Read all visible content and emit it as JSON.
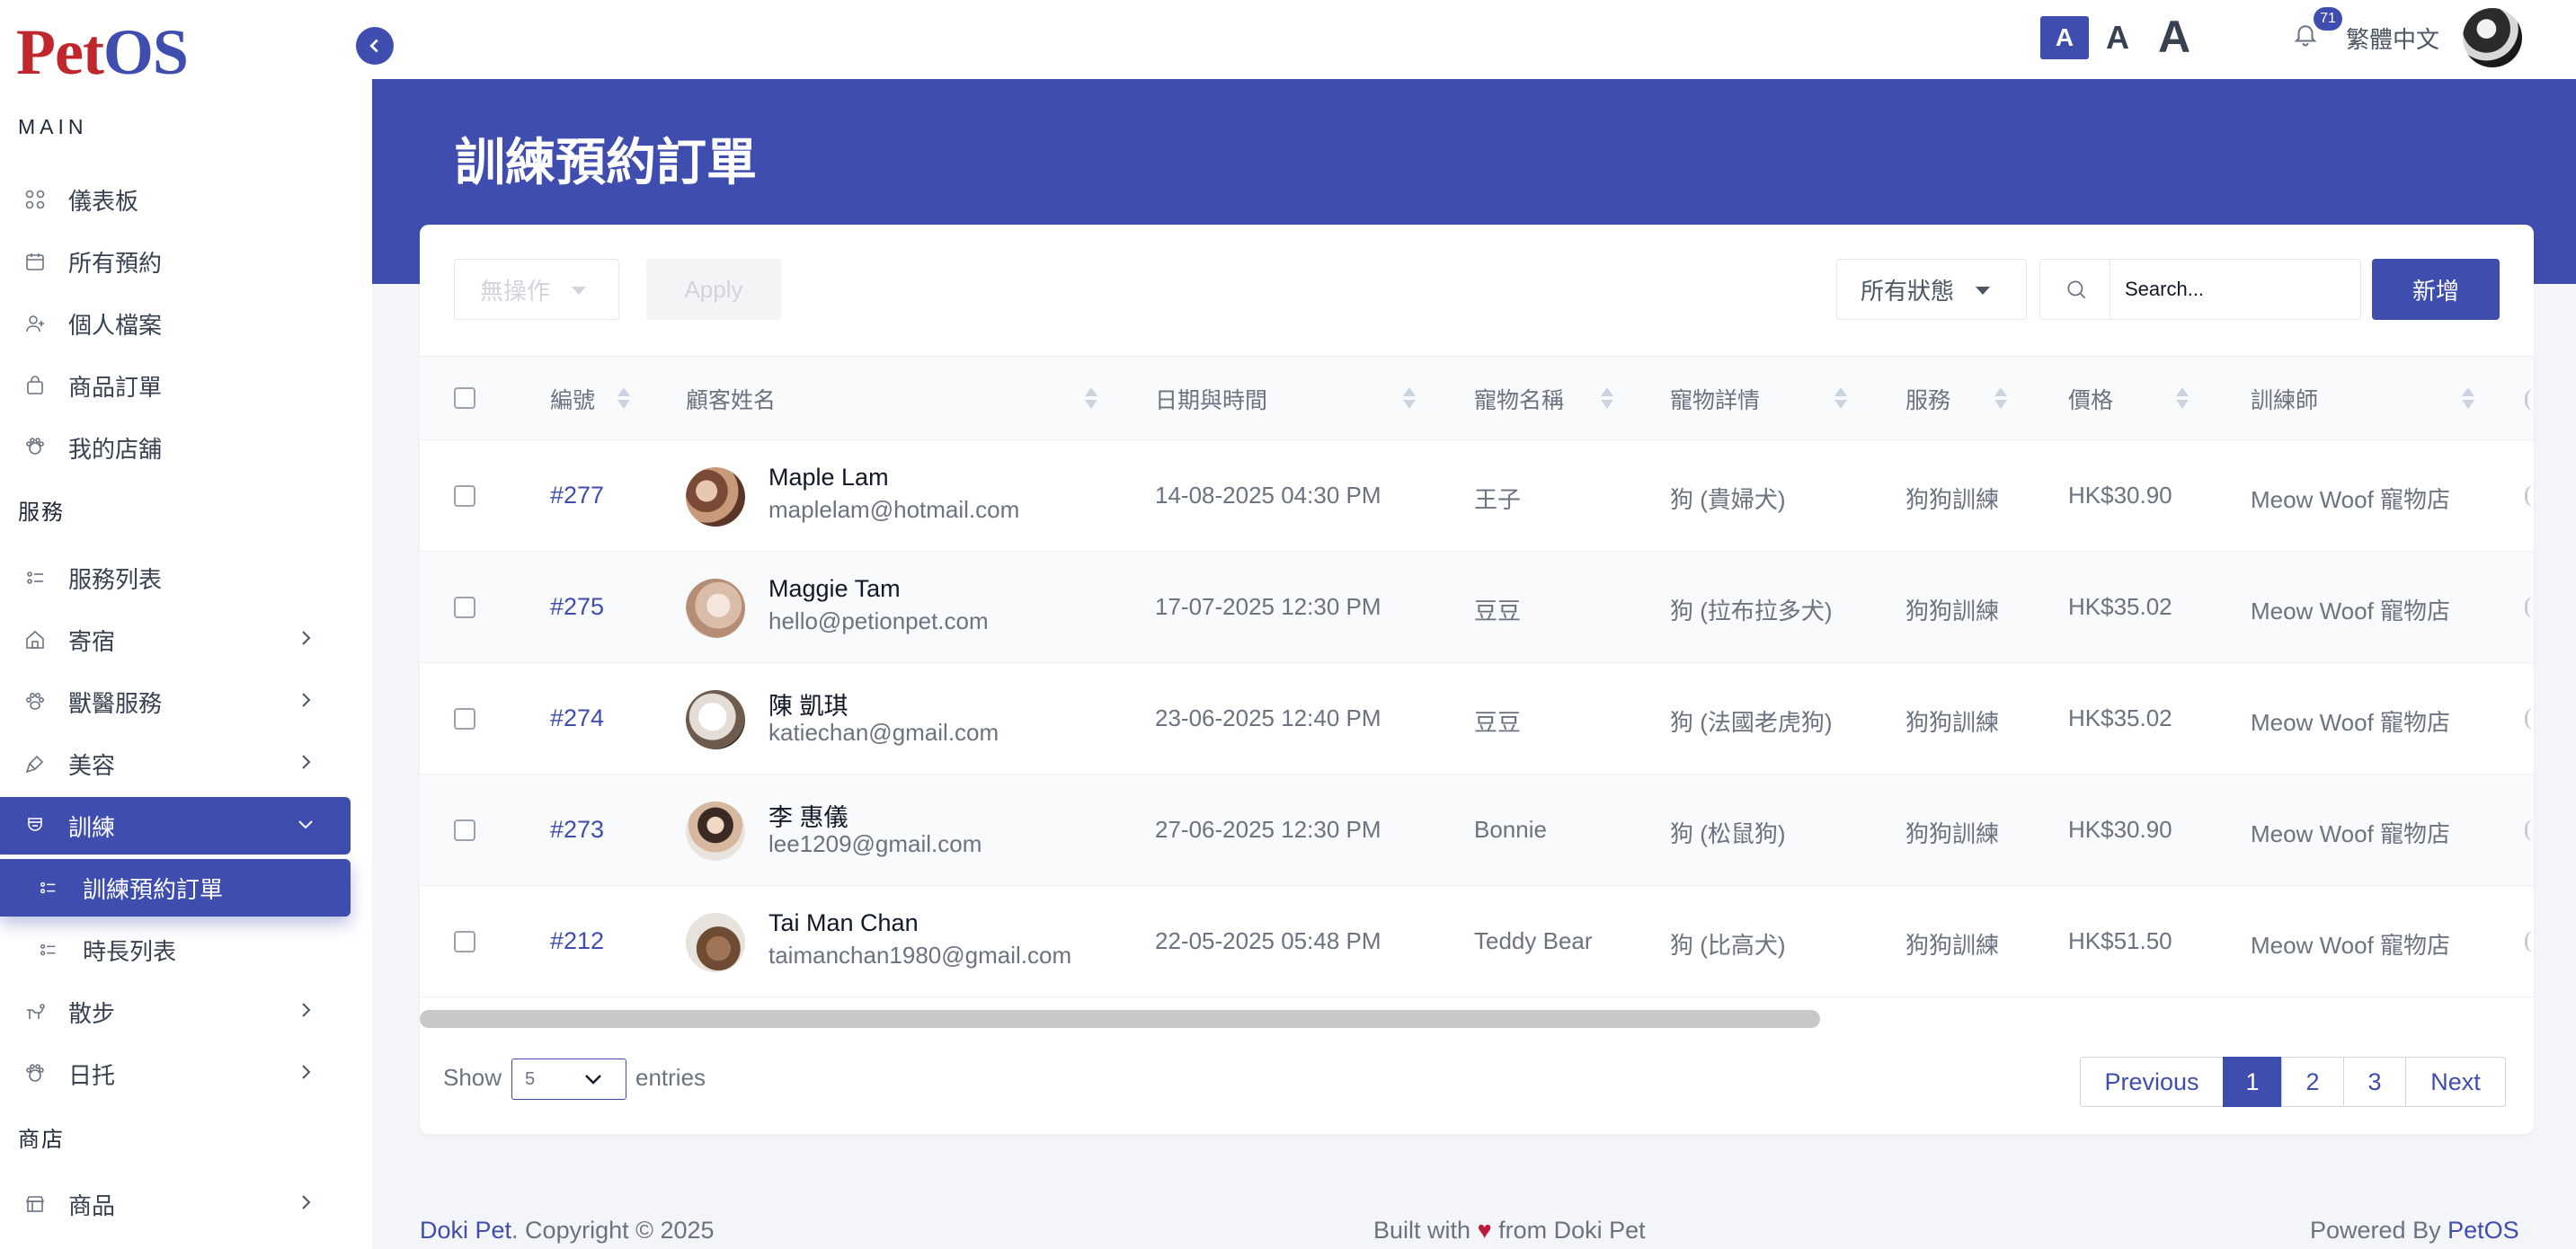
{
  "brand": {
    "logo_part1": "Pet",
    "logo_part2": "OS"
  },
  "sidebar": {
    "section_main": "MAIN",
    "section_services": "服務",
    "section_shop": "商店",
    "items": [
      {
        "label": "儀表板",
        "icon": "grid-icon"
      },
      {
        "label": "所有預約",
        "icon": "calendar-icon"
      },
      {
        "label": "個人檔案",
        "icon": "user-icon"
      },
      {
        "label": "商品訂單",
        "icon": "bag-icon"
      },
      {
        "label": "我的店舖",
        "icon": "store-icon"
      },
      {
        "label": "服務列表",
        "icon": "list-icon"
      },
      {
        "label": "寄宿",
        "icon": "home-icon"
      },
      {
        "label": "獸醫服務",
        "icon": "paw-icon"
      },
      {
        "label": "美容",
        "icon": "brush-icon"
      },
      {
        "label": "訓練",
        "icon": "training-icon"
      },
      {
        "label": "訓練預約訂單",
        "icon": "sub-list-icon"
      },
      {
        "label": "時長列表",
        "icon": "sub-list-icon"
      },
      {
        "label": "散步",
        "icon": "dog-walk-icon"
      },
      {
        "label": "日托",
        "icon": "daycare-icon"
      },
      {
        "label": "商品",
        "icon": "shop-icon"
      }
    ]
  },
  "topbar": {
    "font_small": "A",
    "font_medium": "A",
    "font_large": "A",
    "notification_count": "71",
    "language": "繁體中文"
  },
  "page": {
    "title": "訓練預約訂單"
  },
  "toolbar": {
    "bulk_action": "無操作",
    "apply_label": "Apply",
    "status_filter": "所有狀態",
    "search_placeholder": "Search...",
    "add_label": "新增"
  },
  "table": {
    "columns": [
      "編號",
      "顧客姓名",
      "日期與時間",
      "寵物名稱",
      "寵物詳情",
      "服務",
      "價格",
      "訓練師"
    ],
    "rows": [
      {
        "id": "#277",
        "name": "Maple Lam",
        "email": "maplelam@hotmail.com",
        "datetime": "14-08-2025 04:30 PM",
        "pet": "王子",
        "detail": "狗 (貴婦犬)",
        "service": "狗狗訓練",
        "price": "HK$30.90",
        "trainer": "Meow Woof 寵物店"
      },
      {
        "id": "#275",
        "name": "Maggie Tam",
        "email": "hello@petionpet.com",
        "datetime": "17-07-2025 12:30 PM",
        "pet": "豆豆",
        "detail": "狗 (拉布拉多犬)",
        "service": "狗狗訓練",
        "price": "HK$35.02",
        "trainer": "Meow Woof 寵物店"
      },
      {
        "id": "#274",
        "name": "陳 凱琪",
        "email": "katiechan@gmail.com",
        "datetime": "23-06-2025 12:40 PM",
        "pet": "豆豆",
        "detail": "狗 (法國老虎狗)",
        "service": "狗狗訓練",
        "price": "HK$35.02",
        "trainer": "Meow Woof 寵物店"
      },
      {
        "id": "#273",
        "name": "李 惠儀",
        "email": "lee1209@gmail.com",
        "datetime": "27-06-2025 12:30 PM",
        "pet": "Bonnie",
        "detail": "狗 (松鼠狗)",
        "service": "狗狗訓練",
        "price": "HK$30.90",
        "trainer": "Meow Woof 寵物店"
      },
      {
        "id": "#212",
        "name": "Tai Man Chan",
        "email": "taimanchan1980@gmail.com",
        "datetime": "22-05-2025 05:48 PM",
        "pet": "Teddy Bear",
        "detail": "狗 (比高犬)",
        "service": "狗狗訓練",
        "price": "HK$51.50",
        "trainer": "Meow Woof 寵物店"
      }
    ]
  },
  "pagination": {
    "show_label": "Show",
    "entries_value": "5",
    "entries_label": "entries",
    "previous": "Previous",
    "pages": [
      "1",
      "2",
      "3"
    ],
    "current_page": "1",
    "next": "Next"
  },
  "footer": {
    "left_brand": "Doki Pet",
    "left_text": ". Copyright © 2025",
    "mid_prefix": "Built with",
    "mid_heart": "♥",
    "mid_suffix": "from Doki Pet",
    "right_prefix": "Powered By",
    "right_brand": "PetOS"
  },
  "colors": {
    "accent": "#3f4daf",
    "logo_red": "#c0272d",
    "heart": "#b91c3c"
  }
}
